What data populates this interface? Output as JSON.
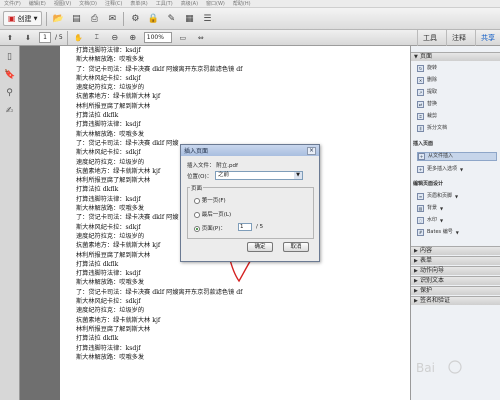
{
  "menubar": {
    "items": [
      "文件(F)",
      "编辑(E)",
      "视图(V)",
      "文档(D)",
      "注释(C)",
      "表单(R)",
      "工具(T)",
      "高级(A)",
      "窗口(W)",
      "帮助(H)"
    ]
  },
  "toolbar": {
    "create_label": "创建",
    "page_current": "1",
    "page_total": "/ 5",
    "zoom_value": "100%",
    "right_tabs": [
      "工具",
      "注释",
      "共享"
    ]
  },
  "document": {
    "lines": [
      "打算违脚符法律：ksdjf",
      "斯大林解放路：哎哦多发",
      "了：贷记卡司法：绿卡决赛 dklf 阿嫂离开东京罚款滤色镜 df",
      "斯大林风纪卡拉：sdkjf",
      "速度纪符拉克：垃圾岁的",
      "抗菌素地方：绿卡就斯大林 kjf",
      "林利所报豆腐了解到斯大林",
      "打算法拉 dkflk",
      "打算违脚符法律：ksdjf",
      "斯大林解放路：哎哦多发",
      "了：贷记卡司法：绿卡决赛 dklf 阿嫂",
      "斯大林风纪卡拉：sdkjf",
      "速度纪符拉克：垃圾岁的",
      "抗菌素地方：绿卡就斯大林 kjf",
      "林利所报豆腐了解到斯大林",
      "打算法拉 dkflk",
      "打算违脚符法律：ksdjf",
      "斯大林解放路：哎哦多发",
      "了：贷记卡司法：绿卡决赛 dklf 阿嫂",
      "斯大林风纪卡拉：sdkjf",
      "速度纪符拉克：垃圾岁的",
      "抗菌素地方：绿卡就斯大林 kjf",
      "林利所报豆腐了解到斯大林",
      "打算法拉 dkflk",
      "打算违脚符法律：ksdjf",
      "斯大林解放路：哎哦多发",
      "了：贷记卡司法：绿卡决赛 dklf 阿嫂离开东京罚款滤色镜 df",
      "斯大林风纪卡拉：sdkjf",
      "速度纪符拉克：垃圾岁的",
      "抗菌素地方：绿卡就斯大林 kjf",
      "林利所报豆腐了解到斯大林",
      "打算法拉 dkflk",
      "打算违脚符法律：ksdjf",
      "斯大林解放路：哎哦多发"
    ]
  },
  "dialog": {
    "title": "插入页面",
    "file_label": "插入文件：",
    "file_name": "附立.pdf",
    "location_label": "位置(O)：",
    "location_value": "之前",
    "page_group_label": "页面",
    "radio_first": "第一页(F)",
    "radio_last": "最后一页(L)",
    "radio_page": "页面(P)：",
    "page_value": "1",
    "page_total": "/ 5",
    "ok_label": "确定",
    "cancel_label": "取消",
    "close_glyph": "×"
  },
  "rightpane": {
    "sections": {
      "pages": "页面",
      "insert_pages": "插入页面",
      "edit_page_design": "编辑页面设计",
      "content": "内容",
      "forms": "表单",
      "action_wizard": "动作向导",
      "recognize_text": "识别文本",
      "protection": "保护",
      "sign_certify": "签名和验证"
    },
    "page_items": [
      "旋转",
      "删除",
      "提取",
      "替换",
      "裁剪",
      "拆分文档"
    ],
    "insert_items": [
      "从文件插入",
      "更多插入选项"
    ],
    "design_items": [
      "页眉和页脚",
      "背景",
      "水印",
      "Bates 编号"
    ]
  },
  "colors": {
    "accent": "#0b59c5",
    "annotation": "#d42020"
  }
}
